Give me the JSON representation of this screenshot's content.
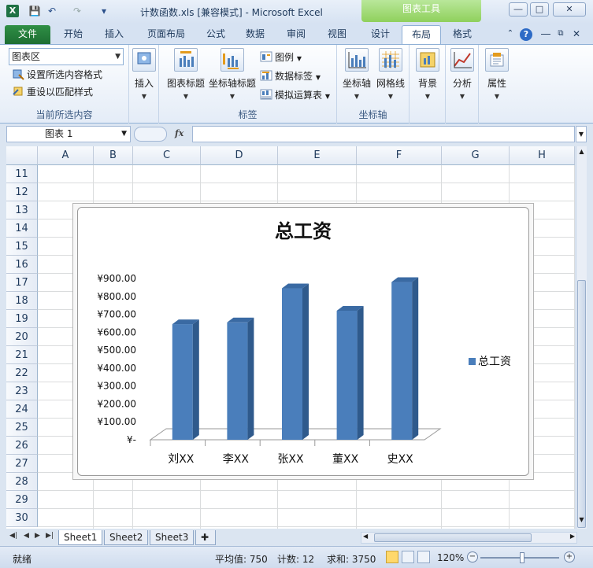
{
  "window": {
    "title": "计数函数.xls  [兼容模式]  -  Microsoft Excel",
    "context_tab_group": "图表工具",
    "controls": [
      "―",
      "□",
      "✕"
    ]
  },
  "tabs": [
    {
      "label": "文件"
    },
    {
      "label": "开始"
    },
    {
      "label": "插入"
    },
    {
      "label": "页面布局"
    },
    {
      "label": "公式"
    },
    {
      "label": "数据"
    },
    {
      "label": "审阅"
    },
    {
      "label": "视图"
    },
    {
      "label": "设计"
    },
    {
      "label": "布局"
    },
    {
      "label": "格式"
    }
  ],
  "ribbon": {
    "current_selection": {
      "combo_value": "图表区",
      "format_selection": "设置所选内容格式",
      "reset_style": "重设以匹配样式",
      "group_label": "当前所选内容"
    },
    "insert": {
      "label": "插入"
    },
    "labels_group": {
      "chart_title": "图表标题",
      "axis_titles": "坐标轴标题",
      "legend": "图例",
      "data_labels": "数据标签",
      "data_table": "模拟运算表",
      "group_label": "标签"
    },
    "axes_group": {
      "axes": "坐标轴",
      "gridlines": "网格线",
      "group_label": "坐标轴"
    },
    "background": {
      "label": "背景"
    },
    "analysis": {
      "label": "分析"
    },
    "properties": {
      "label": "属性"
    }
  },
  "formula_bar": {
    "name_box": "图表 1",
    "fx": "fx",
    "formula": ""
  },
  "grid": {
    "columns": [
      "A",
      "B",
      "C",
      "D",
      "E",
      "F",
      "G",
      "H"
    ],
    "rows": [
      "11",
      "12",
      "13",
      "14",
      "15",
      "16",
      "17",
      "18",
      "19",
      "20",
      "21",
      "22",
      "23",
      "24",
      "25",
      "26",
      "27",
      "28",
      "29",
      "30"
    ]
  },
  "chart_data": {
    "type": "bar",
    "title": "总工资",
    "categories": [
      "刘XX",
      "李XX",
      "张XX",
      "董XX",
      "史XX"
    ],
    "series": [
      {
        "name": "总工资",
        "values": [
          645,
          655,
          845,
          720,
          880
        ],
        "color": "#4a7ebb"
      }
    ],
    "ytick_labels": [
      "¥-",
      "¥100.00",
      "¥200.00",
      "¥300.00",
      "¥400.00",
      "¥500.00",
      "¥600.00",
      "¥700.00",
      "¥800.00",
      "¥900.00"
    ],
    "ylim": [
      0,
      900
    ],
    "legend_position": "right",
    "style": "3d-column"
  },
  "sheets": [
    {
      "label": "Sheet1",
      "active": true
    },
    {
      "label": "Sheet2",
      "active": false
    },
    {
      "label": "Sheet3",
      "active": false
    }
  ],
  "status": {
    "ready": "就绪",
    "average": "平均值: 750",
    "count": "计数: 12",
    "sum": "求和: 3750",
    "zoom": "120%"
  }
}
